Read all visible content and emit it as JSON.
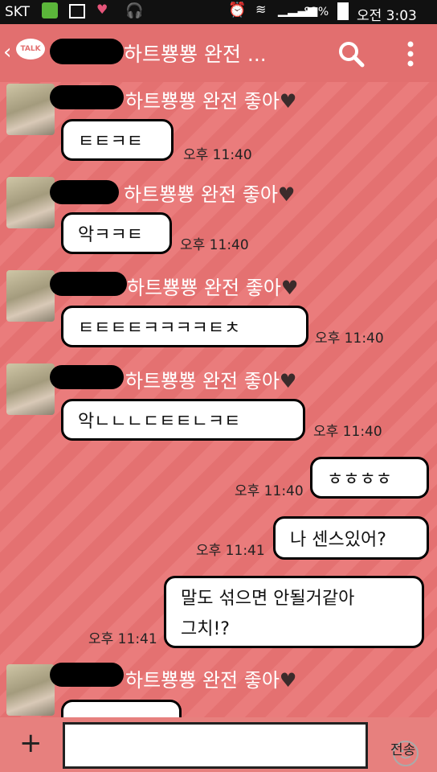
{
  "status_bar": {
    "carrier": "SKT",
    "battery": "82%",
    "time": "오전 3:03"
  },
  "header": {
    "back_icon": "chevron-left",
    "talk_badge": "TALK",
    "title": "하트뿅뿅 완전 ...",
    "search_icon": "search",
    "menu_icon": "more-vertical"
  },
  "messages": [
    {
      "sender_name": "하트뿅뿅 완전 좋아",
      "text": "ㅌㅌㅋㅌ",
      "time": "오후 11:40"
    },
    {
      "sender_name": "하트뿅뿅 완전 좋아",
      "text": "악ㅋㅋㅌ",
      "time": "오후 11:40"
    },
    {
      "sender_name": "하트뿅뿅 완전 좋아",
      "text": "ㅌㅌㅌㅌㅋㅋㅋㅋㅌㅊ",
      "time": "오후 11:40"
    },
    {
      "sender_name": "하트뿅뿅 완전 좋아",
      "text": "악ㄴㄴㄴㄷㅌㅌㄴㅋㅌ",
      "time": "오후 11:40"
    },
    {
      "mine": true,
      "text": "ㅎㅎㅎㅎ",
      "time": "오후 11:40"
    },
    {
      "mine": true,
      "text": "나 센스있어?",
      "time": "오후 11:41"
    },
    {
      "mine": true,
      "text_line1": "말도 섞으면 안될거같아",
      "text_line2": "그치!?",
      "time": "오후 11:41"
    },
    {
      "sender_name": "하트뿅뿅 완전 좋아"
    }
  ],
  "input_bar": {
    "add_icon": "plus",
    "emoji_icon": "smiley",
    "send_label": "전송"
  },
  "colors": {
    "background": "#e87575",
    "header": "#e26f6f",
    "bubble": "#ffffff",
    "status_bar": "#111111"
  }
}
